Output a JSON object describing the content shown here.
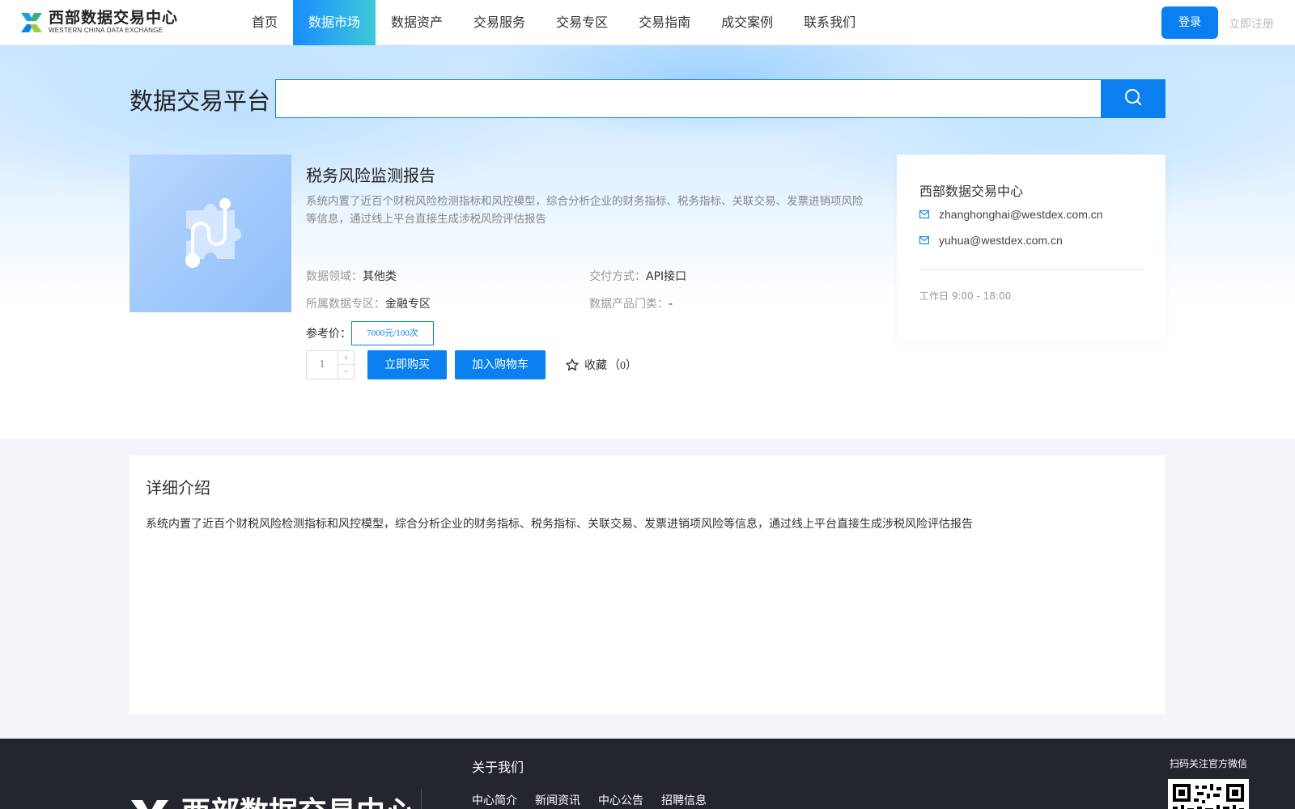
{
  "header": {
    "logo_cn": "西部数据交易中心",
    "logo_en": "WESTERN CHINA DATA EXCHANGE",
    "nav": [
      {
        "label": "首页",
        "active": false
      },
      {
        "label": "数据市场",
        "active": true
      },
      {
        "label": "数据资产",
        "active": false
      },
      {
        "label": "交易服务",
        "active": false
      },
      {
        "label": "交易专区",
        "active": false
      },
      {
        "label": "交易指南",
        "active": false
      },
      {
        "label": "成交案例",
        "active": false
      },
      {
        "label": "联系我们",
        "active": false
      }
    ],
    "login_label": "登录",
    "register_label": "立即注册"
  },
  "search": {
    "title": "数据交易平台",
    "value": "",
    "placeholder": ""
  },
  "product": {
    "name": "税务风险监测报告",
    "description": "系统内置了近百个财税风险检测指标和风控模型，综合分析企业的财务指标、税务指标、关联交易、发票进销项风险等信息，通过线上平台直接生成涉税风险评估报告",
    "domain_key": "数据领域：",
    "domain_value": "其他类",
    "delivery_key": "交付方式：",
    "delivery_value": "API接口",
    "zone_key": "所属数据专区：",
    "zone_value": "金融专区",
    "category_key": "数据产品门类：",
    "category_value": "-",
    "price_label": "参考价：",
    "price_option": "7000元/100次",
    "quantity": "1",
    "qty_plus": "+",
    "qty_minus": "−",
    "buy_now_label": "立即购买",
    "add_cart_label": "加入购物车",
    "favorite_label": "收藏",
    "favorite_count": "（0）"
  },
  "contact": {
    "title": "西部数据交易中心",
    "emails": [
      "zhanghonghai@westdex.com.cn",
      "yuhua@westdex.com.cn"
    ],
    "hours": "工作日 9:00 - 18:00"
  },
  "detail": {
    "title": "详细介绍",
    "text": "系统内置了近百个财税风险检测指标和风控模型，综合分析企业的财务指标、税务指标、关联交易、发票进销项风险等信息，通过线上平台直接生成涉税风险评估报告"
  },
  "footer": {
    "logo_text": "西部数据交易中心",
    "about_title": "关于我们",
    "links": [
      "中心简介",
      "新闻资讯",
      "中心公告",
      "招聘信息"
    ],
    "qr_label": "扫码关注官方微信"
  },
  "colors": {
    "primary": "#0a7ff0",
    "nav_active_start": "#1a8cff",
    "nav_active_end": "#3dc9d8",
    "footer_bg": "#23262d"
  },
  "icons": {
    "search": "search-icon",
    "email": "mail-icon",
    "favorite": "star-outline-icon",
    "product": "puzzle-route-icon"
  }
}
